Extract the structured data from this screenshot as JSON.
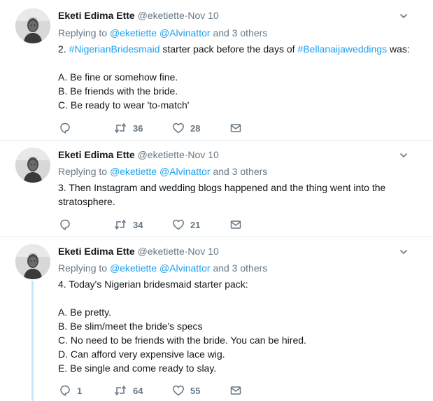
{
  "tweets": [
    {
      "name": "Eketi Edima Ette",
      "handle": "@eketiette",
      "sep": "·",
      "time": "Nov 10",
      "replying_prefix": "Replying to",
      "reply_handles": [
        "@eketiette",
        "@Alvinattor"
      ],
      "reply_suffix": "and 3 others",
      "text_lines": [
        {
          "parts": [
            {
              "t": "2. ",
              "link": false
            },
            {
              "t": "#NigerianBridesmaid",
              "link": true
            },
            {
              "t": " starter pack before the days of ",
              "link": false
            },
            {
              "t": "#Bellanaijaweddings",
              "link": true
            },
            {
              "t": " was:",
              "link": false
            }
          ]
        },
        {
          "parts": [
            {
              "t": "",
              "link": false
            }
          ]
        },
        {
          "parts": [
            {
              "t": "A. Be fine or somehow fine.",
              "link": false
            }
          ]
        },
        {
          "parts": [
            {
              "t": "B. Be friends with the bride.",
              "link": false
            }
          ]
        },
        {
          "parts": [
            {
              "t": "C. Be ready to wear 'to-match'",
              "link": false
            }
          ]
        }
      ],
      "replies": "",
      "retweets": "36",
      "likes": "28"
    },
    {
      "name": "Eketi Edima Ette",
      "handle": "@eketiette",
      "sep": "·",
      "time": "Nov 10",
      "replying_prefix": "Replying to",
      "reply_handles": [
        "@eketiette",
        "@Alvinattor"
      ],
      "reply_suffix": "and 3 others",
      "text_lines": [
        {
          "parts": [
            {
              "t": "3. Then Instagram and wedding blogs happened and the thing went into the",
              "link": false
            }
          ]
        },
        {
          "parts": [
            {
              "t": "stratosphere.",
              "link": false
            }
          ]
        }
      ],
      "replies": "",
      "retweets": "34",
      "likes": "21"
    },
    {
      "name": "Eketi Edima Ette",
      "handle": "@eketiette",
      "sep": "·",
      "time": "Nov 10",
      "replying_prefix": "Replying to",
      "reply_handles": [
        "@eketiette",
        "@Alvinattor"
      ],
      "reply_suffix": "and 3 others",
      "text_lines": [
        {
          "parts": [
            {
              "t": "4. Today's Nigerian bridesmaid starter pack:",
              "link": false
            }
          ]
        },
        {
          "parts": [
            {
              "t": "",
              "link": false
            }
          ]
        },
        {
          "parts": [
            {
              "t": "A. Be pretty.",
              "link": false
            }
          ]
        },
        {
          "parts": [
            {
              "t": "B. Be slim/meet the bride's specs",
              "link": false
            }
          ]
        },
        {
          "parts": [
            {
              "t": "C. No need to be friends with the bride. You can be hired.",
              "link": false
            }
          ]
        },
        {
          "parts": [
            {
              "t": "D. Can afford very expensive lace wig.",
              "link": false
            }
          ]
        },
        {
          "parts": [
            {
              "t": "E. Be single and come ready to slay.",
              "link": false
            }
          ]
        }
      ],
      "replies": "1",
      "retweets": "64",
      "likes": "55"
    }
  ],
  "icons": {
    "reply": "reply-icon",
    "retweet": "retweet-icon",
    "like": "heart-icon",
    "dm": "envelope-icon",
    "more": "chevron-down-icon"
  },
  "colors": {
    "link": "#1da1f2",
    "muted": "#657786",
    "thread_line": "#c7e6f8",
    "divider": "#e6ecf0"
  }
}
